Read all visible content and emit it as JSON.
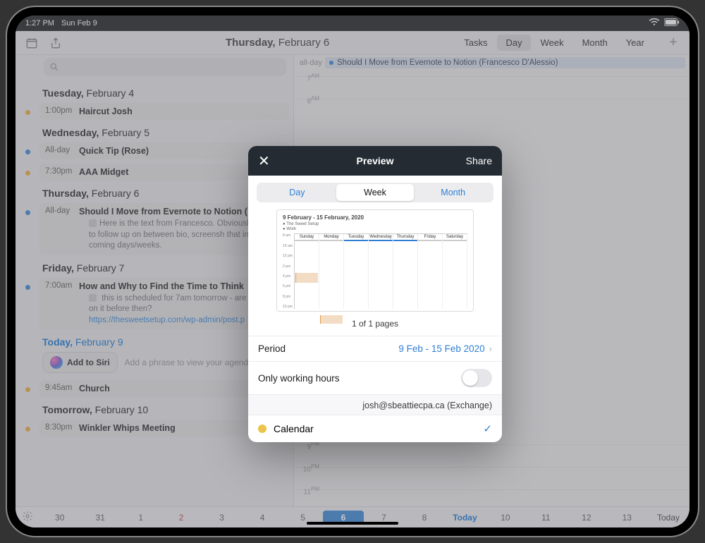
{
  "status": {
    "time": "1:27 PM",
    "date": "Sun Feb 9"
  },
  "header": {
    "title_weekday": "Thursday,",
    "title_rest": " February 6",
    "views": [
      "Tasks",
      "Day",
      "Week",
      "Month",
      "Year"
    ],
    "active_view": "Day"
  },
  "sidebar": {
    "search_placeholder": "",
    "days": [
      {
        "weekday": "Tuesday,",
        "rest": " February 4",
        "events": [
          {
            "dot": "orange",
            "time": "1:00pm",
            "title": "Haircut Josh"
          }
        ]
      },
      {
        "weekday": "Wednesday,",
        "rest": " February 5",
        "events": [
          {
            "dot": "blue",
            "time": "All-day",
            "title": "Quick Tip (Rose)"
          },
          {
            "dot": "orange",
            "time": "7:30pm",
            "title": "AAA Midget"
          }
        ]
      },
      {
        "weekday": "Thursday,",
        "rest": " February 6",
        "events": [
          {
            "dot": "blue",
            "time": "All-day",
            "title": "Should I Move from Evernote to Notion (",
            "desc": "Here is the text from Francesco. Obviously h things to follow up on between bio, screensh that in the coming days/weeks."
          }
        ]
      },
      {
        "weekday": "Friday,",
        "rest": " February 7",
        "events": [
          {
            "dot": "blue",
            "time": "7:00am",
            "title": "How and Why to Find the Time to Think",
            "desc": " this is scheduled for 7am tomorrow - are yo eyes on it before then?",
            "link": "https://thesweetsetup.com/wp-admin/post.p"
          }
        ]
      },
      {
        "today": true,
        "weekday": "Today,",
        "rest": " February 9",
        "siri": {
          "label": "Add to Siri",
          "hint": "Add a phrase to view your agenda"
        },
        "events": [
          {
            "dot": "orange",
            "time": "9:45am",
            "title": "Church"
          }
        ]
      },
      {
        "weekday": "Tomorrow,",
        "rest": " February 10",
        "events": [
          {
            "dot": "orange",
            "time": "8:30pm",
            "title": "Winkler Whips Meeting"
          }
        ]
      }
    ]
  },
  "daycol": {
    "allday_label": "all-day",
    "allday_event": "Should I Move from Evernote to Notion (Francesco D'Alessio)",
    "hours": [
      "7",
      "8",
      "9",
      "10",
      "11"
    ],
    "suffixes": [
      "AM",
      "AM",
      "PM",
      "PM",
      "PM"
    ]
  },
  "datestrip": {
    "cells": [
      "30",
      "31",
      "1",
      "2",
      "3",
      "4",
      "5",
      "6",
      "7",
      "8",
      "Today",
      "10",
      "11",
      "12",
      "13"
    ],
    "active_index": 7,
    "today_index": 10,
    "sun_index": 3,
    "today_btn": "Today"
  },
  "modal": {
    "title": "Preview",
    "share": "Share",
    "seg": [
      "Day",
      "Week",
      "Month"
    ],
    "seg_active": 1,
    "preview_title": "9 February - 15 February, 2020",
    "preview_legend": [
      "The Sweet Setup",
      "Work"
    ],
    "wk_heads": [
      "Sunday",
      "Monday",
      "Tuesday",
      "Wednesday",
      "Thursday",
      "Friday",
      "Saturday"
    ],
    "pager": "1 of 1 pages",
    "period_label": "Period",
    "period_value": "9 Feb - 15 Feb 2020",
    "working_label": "Only working hours",
    "account": "josh@sbeattiecpa.ca (Exchange)",
    "calendars": [
      {
        "name": "Calendar",
        "color": "#ebc44a",
        "checked": true
      }
    ]
  }
}
